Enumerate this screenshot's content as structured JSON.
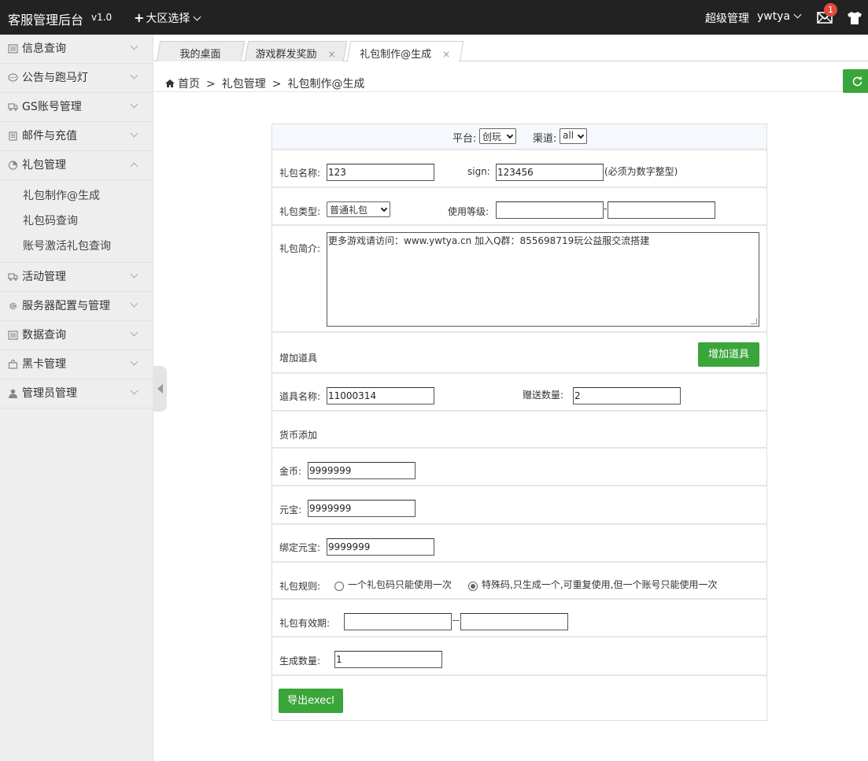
{
  "header": {
    "brand": "客服管理后台",
    "version": "v1.0",
    "region_label": "大区选择",
    "role": "超级管理",
    "username": "ywtya",
    "badge_count": "1"
  },
  "sidebar": {
    "items": [
      {
        "label": "信息查询",
        "icon": "list-icon"
      },
      {
        "label": "公告与跑马灯",
        "icon": "chat-icon"
      },
      {
        "label": "GS账号管理",
        "icon": "truck-icon"
      },
      {
        "label": "邮件与充值",
        "icon": "building-icon"
      },
      {
        "label": "礼包管理",
        "icon": "pie-icon"
      },
      {
        "label": "活动管理",
        "icon": "truck-icon"
      },
      {
        "label": "服务器配置与管理",
        "icon": "gear-icon"
      },
      {
        "label": "数据查询",
        "icon": "list-icon"
      },
      {
        "label": "黑卡管理",
        "icon": "bag-icon"
      },
      {
        "label": "管理员管理",
        "icon": "user-icon"
      }
    ],
    "sub_items": [
      "礼包制作@生成",
      "礼包码查询",
      "账号激活礼包查询"
    ]
  },
  "tabs": [
    {
      "label": "我的桌面"
    },
    {
      "label": "游戏群发奖励",
      "close": "×"
    },
    {
      "label": "礼包制作@生成",
      "close": "×"
    }
  ],
  "breadcrumb": {
    "home": "首页",
    "sep": ">",
    "section": "礼包管理",
    "page": "礼包制作@生成"
  },
  "form": {
    "platform_label": "平台:",
    "platform_value": "创玩",
    "channel_label": "渠道:",
    "channel_value": "all",
    "name_label": "礼包名称:",
    "name_value": "123",
    "sign_label": "sign:",
    "sign_value": "123456",
    "sign_hint": "(必须为数字整型)",
    "type_label": "礼包类型:",
    "type_value": "普通礼包",
    "level_label": "使用等级:",
    "level_sep": "-",
    "desc_label": "礼包简介:",
    "desc_value": "更多游戏请访问：www.ywtya.cn  加入Q群：855698719玩公益服交流搭建",
    "add_item_label": "增加道具",
    "add_item_button": "增加道具",
    "item_name_label": "道具名称:",
    "item_name_value": "11000314",
    "gift_qty_label": "赠送数量:",
    "gift_qty_value": "2",
    "currency_label": "货币添加",
    "gold_label": "金币:",
    "gold_value": "9999999",
    "yuanbao_label": "元宝:",
    "yuanbao_value": "9999999",
    "bound_yuanbao_label": "绑定元宝:",
    "bound_yuanbao_value": "9999999",
    "rule_label": "礼包规则:",
    "rule_option1": "一个礼包码只能使用一次",
    "rule_option2": "特殊码,只生成一个,可重复使用,但一个账号只能使用一次",
    "validity_label": "礼包有效期:",
    "validity_sep": "--",
    "gen_qty_label": "生成数量:",
    "gen_qty_value": "1",
    "export_button": "导出execl"
  },
  "colors": {
    "topbar": "#222222",
    "accent_green": "#3aa53a",
    "badge_red": "#e24a3b",
    "sidebar_bg": "#eeeeee"
  }
}
